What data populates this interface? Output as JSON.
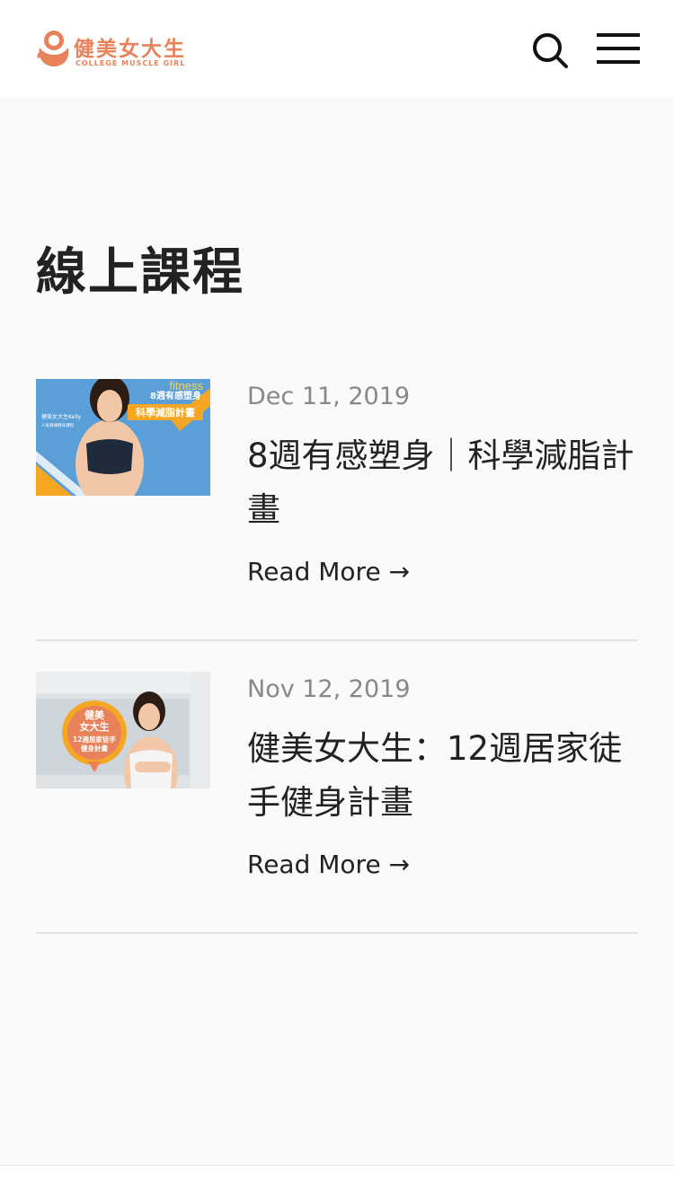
{
  "header": {
    "logo_text": "健美女大生",
    "logo_subtext": "COLLEGE MUSCLE GIRL",
    "search_icon": "search-icon",
    "menu_icon": "hamburger-menu-icon"
  },
  "page": {
    "title": "線上課程"
  },
  "posts": [
    {
      "date": "Dec 11, 2019",
      "title": "8週有感塑身｜科學減脂計畫",
      "read_more": "Read More →",
      "thumb": {
        "tag": "fitness",
        "line1": "8週有感塑身",
        "line2": "科學減脂計畫",
        "caption": "健美女大生Kelly",
        "caption2": "人氣教練健身課程"
      }
    },
    {
      "date": "Nov 12, 2019",
      "title": "健美女大生：12週居家徒手健身計畫",
      "read_more": "Read More →",
      "thumb": {
        "line1": "健美",
        "line2": "女大生",
        "line3": "12週居家徒手",
        "line4": "健身計畫"
      }
    }
  ],
  "colors": {
    "brand": "#e8825a",
    "background": "#fafafa",
    "text": "#222222",
    "muted": "#888888",
    "thumb1_bg": "#5a9fd8",
    "thumb1_accent": "#f5a623"
  }
}
